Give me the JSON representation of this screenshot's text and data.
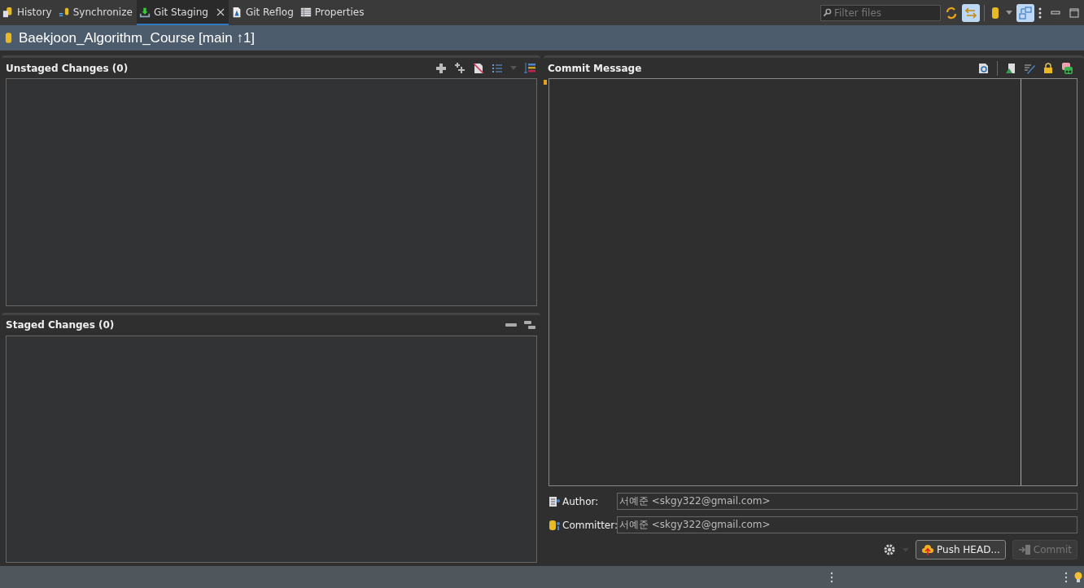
{
  "tabs": [
    {
      "label": "History",
      "kind": "history",
      "selected": false,
      "closable": false
    },
    {
      "label": "Synchronize",
      "kind": "sync",
      "selected": false,
      "closable": false
    },
    {
      "label": "Git Staging",
      "kind": "staging",
      "selected": true,
      "closable": true
    },
    {
      "label": "Git Reflog",
      "kind": "reflog",
      "selected": false,
      "closable": false
    },
    {
      "label": "Properties",
      "kind": "properties",
      "selected": false,
      "closable": false
    }
  ],
  "filter": {
    "placeholder": "Filter files"
  },
  "repository": {
    "title": "Baekjoon_Algorithm_Course [main ↑1]"
  },
  "unstaged": {
    "title": "Unstaged Changes (0)"
  },
  "staged": {
    "title": "Staged Changes (0)"
  },
  "commit_message": {
    "title": "Commit Message"
  },
  "author": {
    "label": "Author:",
    "value": "서예준 <skgy322@gmail.com>"
  },
  "committer": {
    "label": "Committer:",
    "value": "서예준 <skgy322@gmail.com>"
  },
  "buttons": [
    {
      "label": "Push HEAD...",
      "kind": "push",
      "disabled": false
    },
    {
      "label": "Commit",
      "kind": "commit",
      "disabled": true
    }
  ]
}
